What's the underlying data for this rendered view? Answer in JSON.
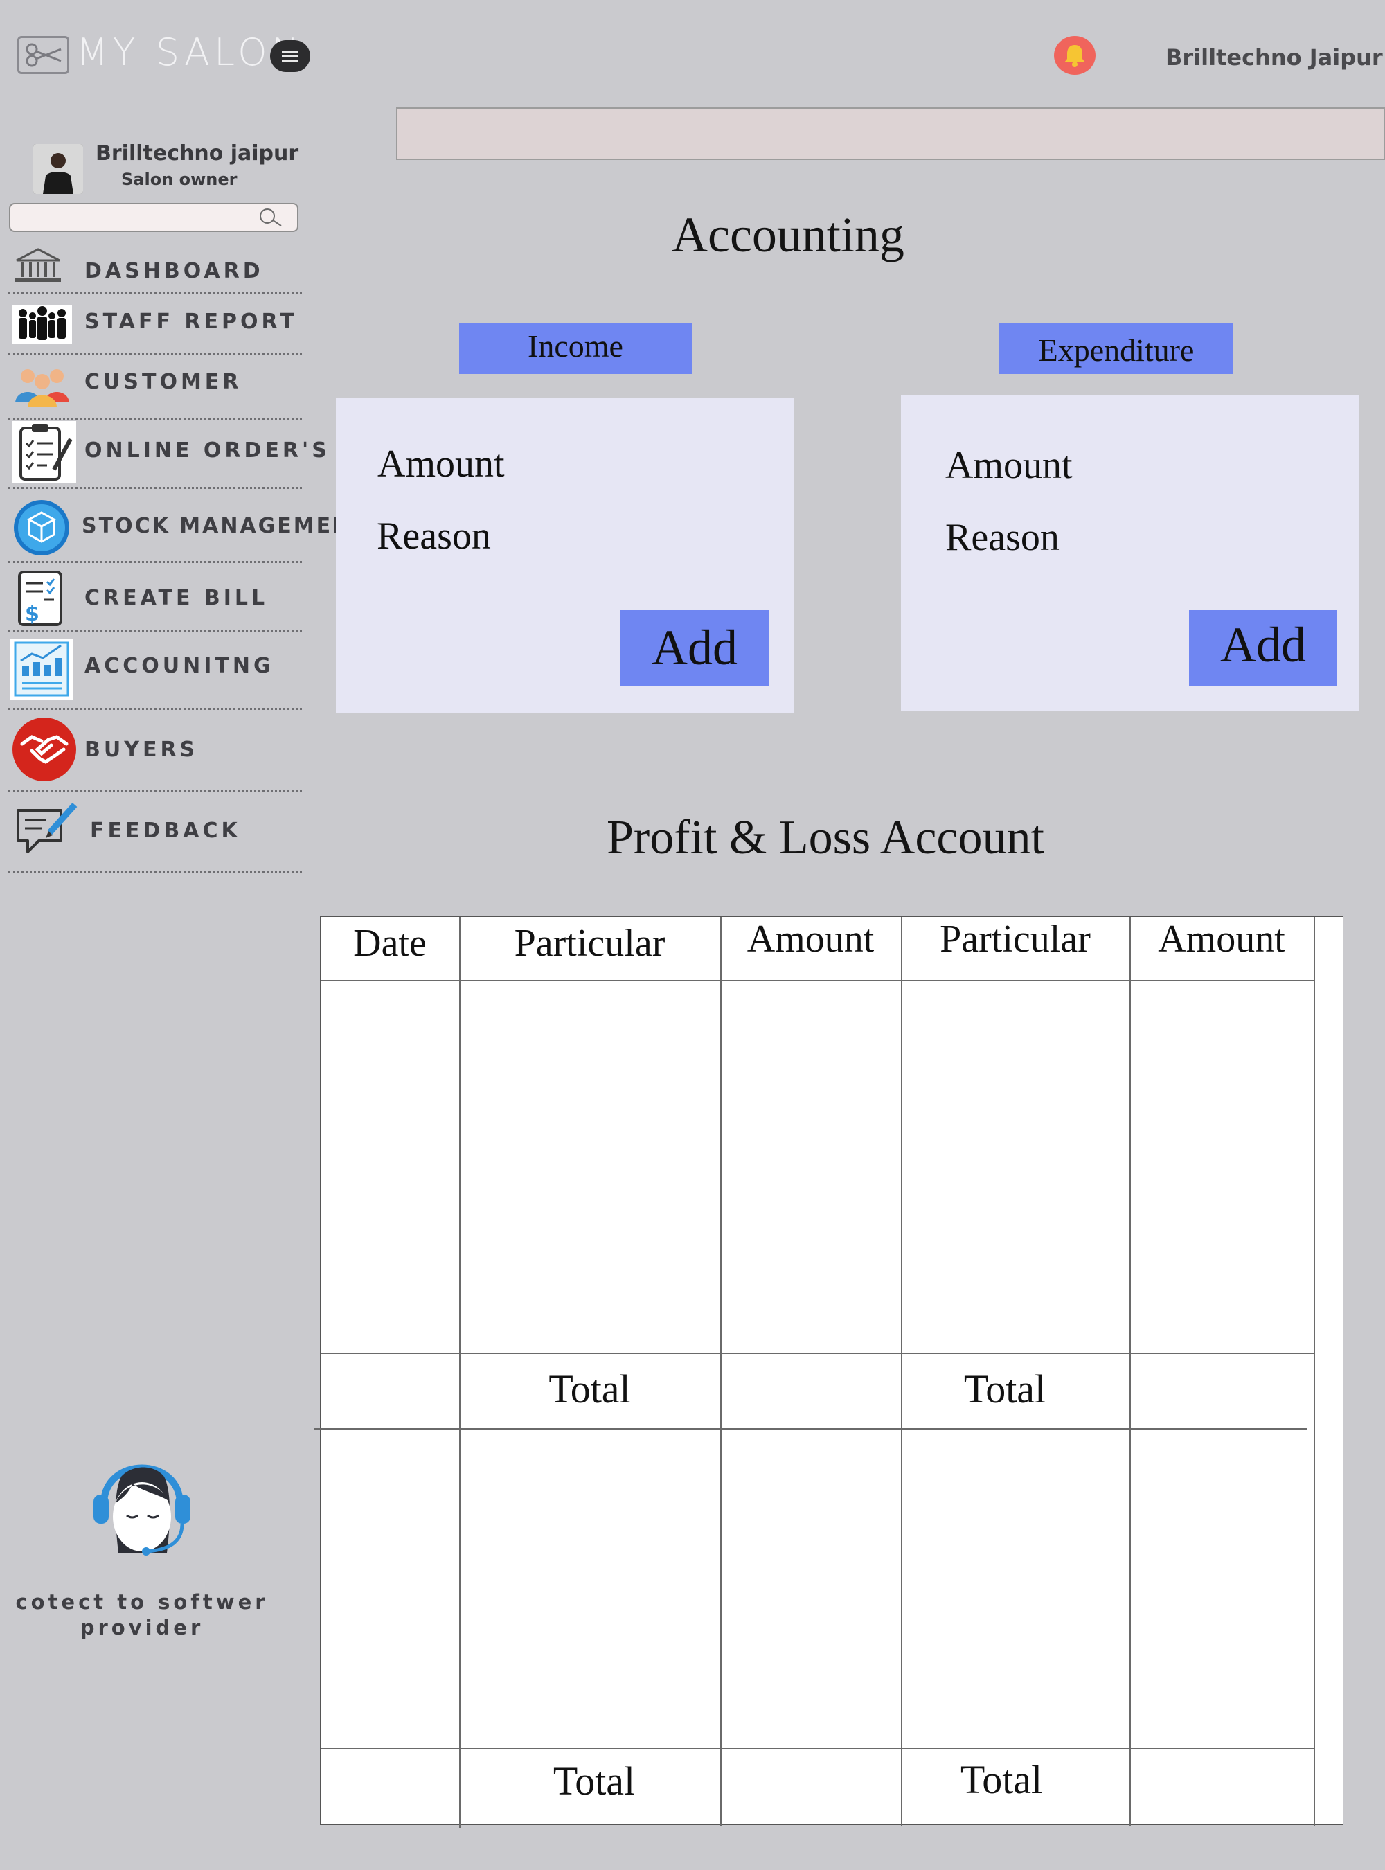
{
  "app": {
    "title": "MY SALON",
    "user_name": "Brilltechno Jaipur"
  },
  "profile": {
    "name": "Brilltechno jaipur",
    "role": "Salon owner"
  },
  "sidebar": {
    "search_placeholder": "",
    "items": [
      {
        "label": "DASHBOARD",
        "icon": "bank-building-icon"
      },
      {
        "label": "STAFF REPORT",
        "icon": "staff-group-icon"
      },
      {
        "label": "CUSTOMER",
        "icon": "customers-icon"
      },
      {
        "label": "ONLINE ORDER'S",
        "icon": "clipboard-checklist-icon"
      },
      {
        "label": "STOCK MANAGEMENT",
        "icon": "stock-boxes-icon"
      },
      {
        "label": "CREATE BILL",
        "icon": "bill-dollar-icon"
      },
      {
        "label": "ACCOUNITNG",
        "icon": "accounting-chart-icon"
      },
      {
        "label": "BUYERS",
        "icon": "handshake-icon"
      },
      {
        "label": "FEEDBACK",
        "icon": "feedback-pen-icon"
      }
    ]
  },
  "support": {
    "text": "cotect to softwer provider",
    "icon": "support-headset-icon"
  },
  "accounting": {
    "title": "Accounting",
    "income": {
      "tab": "Income",
      "amount_label": "Amount",
      "reason_label": "Reason",
      "add_label": "Add"
    },
    "expenditure": {
      "tab": "Expenditure",
      "amount_label": "Amount",
      "reason_label": "Reason",
      "add_label": "Add"
    }
  },
  "pl": {
    "title": "Profit & Loss Account",
    "columns": [
      "Date",
      "Particular",
      "Amount",
      "Particular",
      "Amount"
    ],
    "total_label": "Total"
  },
  "colors": {
    "accent": "#6f86f2",
    "panel": "#e6e6f4",
    "background": "#cacace",
    "bell": "#f0645c"
  }
}
